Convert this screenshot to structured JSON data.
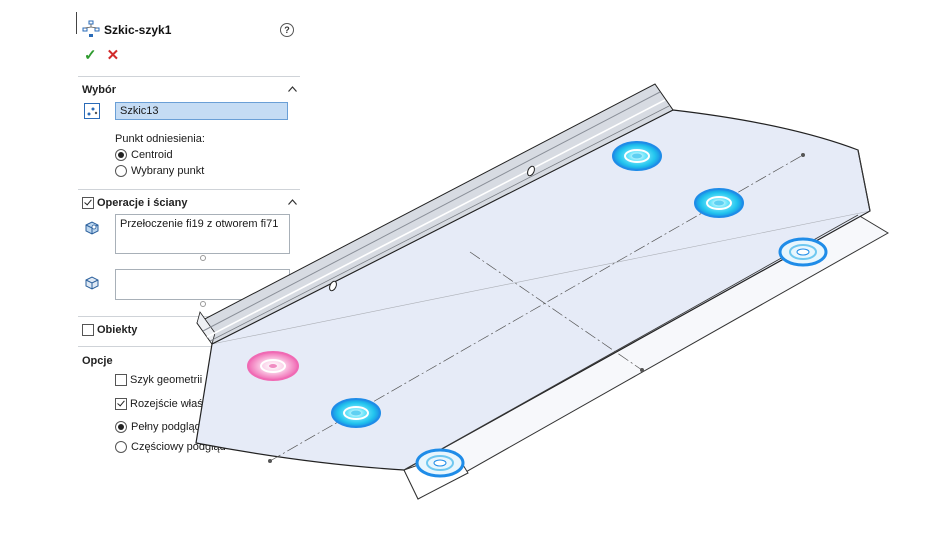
{
  "property_manager": {
    "title": "Szkic-szyk1",
    "help_icon": "?",
    "ok_icon": "✓",
    "cancel_icon": "✕",
    "selection": {
      "heading": "Wybór",
      "sketch_value": "Szkic13",
      "reference_label": "Punkt odniesienia:",
      "options": [
        "Centroid",
        "Wybrany punkt"
      ],
      "selected_option": "Centroid"
    },
    "features": {
      "heading": "Operacje i ściany",
      "checked": true,
      "features_list": [
        "Przełoczenie fi19 z otworem fi71"
      ],
      "faces_list": []
    },
    "bodies": {
      "heading": "Obiekty",
      "checked": false
    },
    "options": {
      "heading": "Opcje",
      "geometry_pattern": "Szyk geometrii",
      "geometry_pattern_checked": false,
      "propagate": "Rozejście właściwości wizualnych",
      "propagate_checked": true,
      "full_preview": "Pełny podgląd",
      "partial_preview": "Częściowy podgląd",
      "preview_selected": "Pełny podgląd"
    }
  },
  "colors": {
    "pattern_preview": "#22c4ee",
    "seed_highlight": "#f06ab4",
    "selection_blue": "#1f8ce8",
    "plate_top": "#e6ebf7"
  }
}
